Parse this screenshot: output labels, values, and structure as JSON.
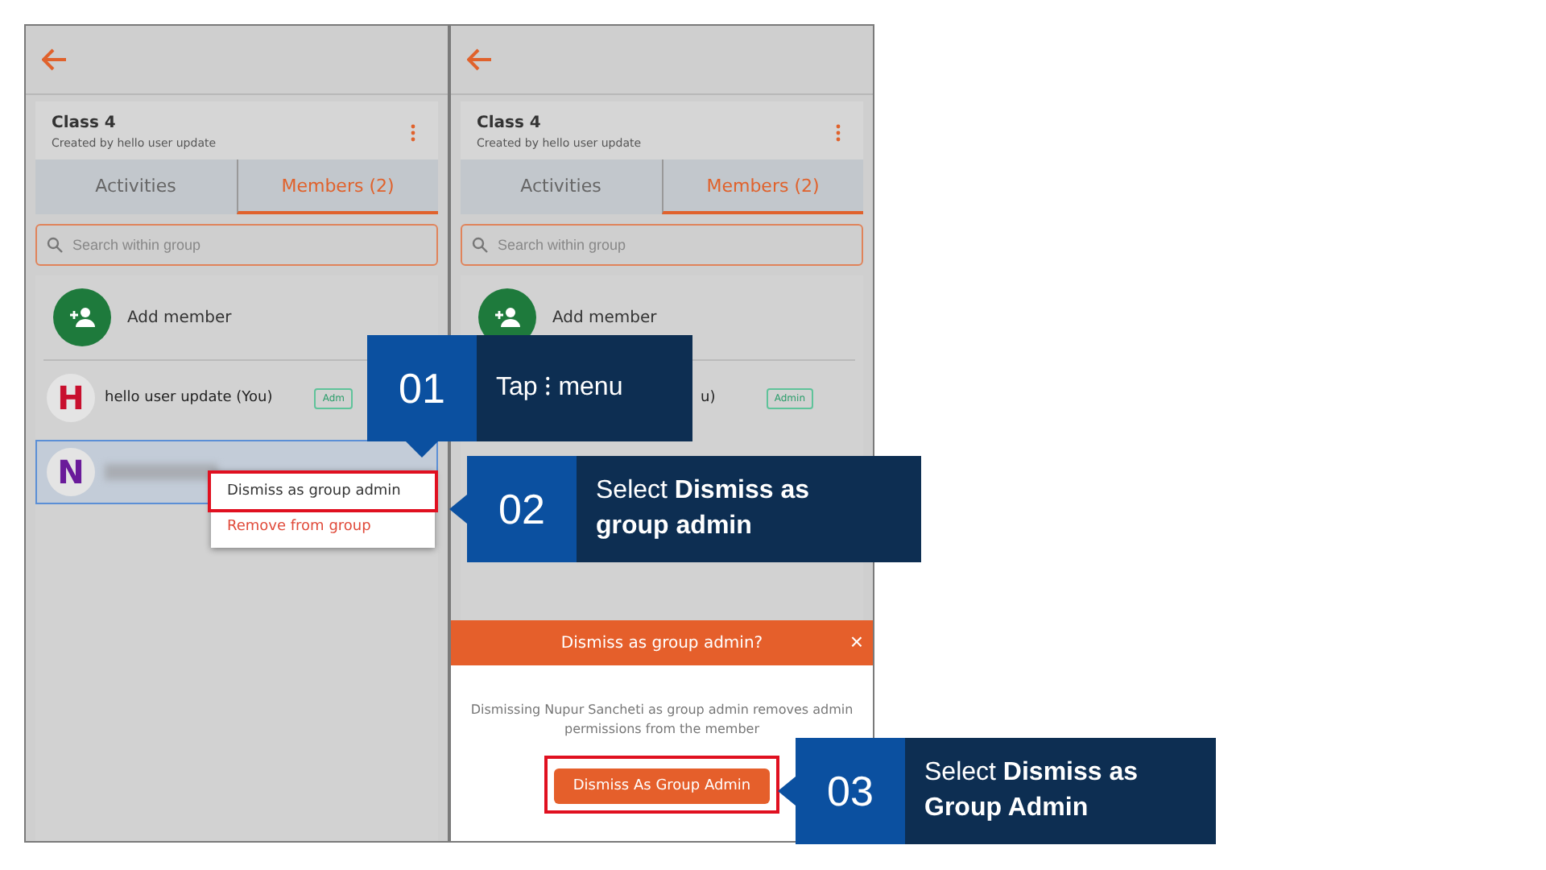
{
  "screens": [
    {
      "title": "Class 4",
      "subtitle": "Created by hello user update",
      "tabs": [
        {
          "label": "Activities",
          "selected": false
        },
        {
          "label": "Members (2)",
          "selected": true
        }
      ],
      "search": {
        "placeholder": "Search within group"
      },
      "add_member": "Add member",
      "members": [
        {
          "initial": "H",
          "color": "#c8102e",
          "name": "hello user update (You)",
          "badge": "Adm",
          "highlighted": false
        },
        {
          "initial": "N",
          "color": "#6a1b9a",
          "highlighted": true
        }
      ],
      "menu": {
        "items": [
          {
            "label": "Dismiss as group admin",
            "kind": "normal",
            "outlined": true
          },
          {
            "label": "Remove from group",
            "kind": "danger",
            "outlined": false
          }
        ]
      }
    },
    {
      "title": "Class 4",
      "subtitle": "Created by hello user update",
      "tabs": [
        {
          "label": "Activities",
          "selected": false
        },
        {
          "label": "Members (2)",
          "selected": true
        }
      ],
      "search": {
        "placeholder": "Search within group"
      },
      "add_member": "Add member",
      "members": [
        {
          "name": "u)",
          "badge": "Admin",
          "highlighted": false
        }
      ],
      "dialog": {
        "title": "Dismiss as group admin?",
        "close": "×",
        "message": "Dismissing Nupur Sancheti as group admin removes admin permissions from the member",
        "button": "Dismiss As Group Admin",
        "button_outlined": true
      }
    }
  ],
  "callouts": [
    {
      "number": "01",
      "text": "Tap ⁝ menu"
    },
    {
      "number": "02",
      "text": "Select **Dismiss as group admin**"
    },
    {
      "number": "03",
      "text": "Select **Dismiss as Group Admin**"
    }
  ]
}
